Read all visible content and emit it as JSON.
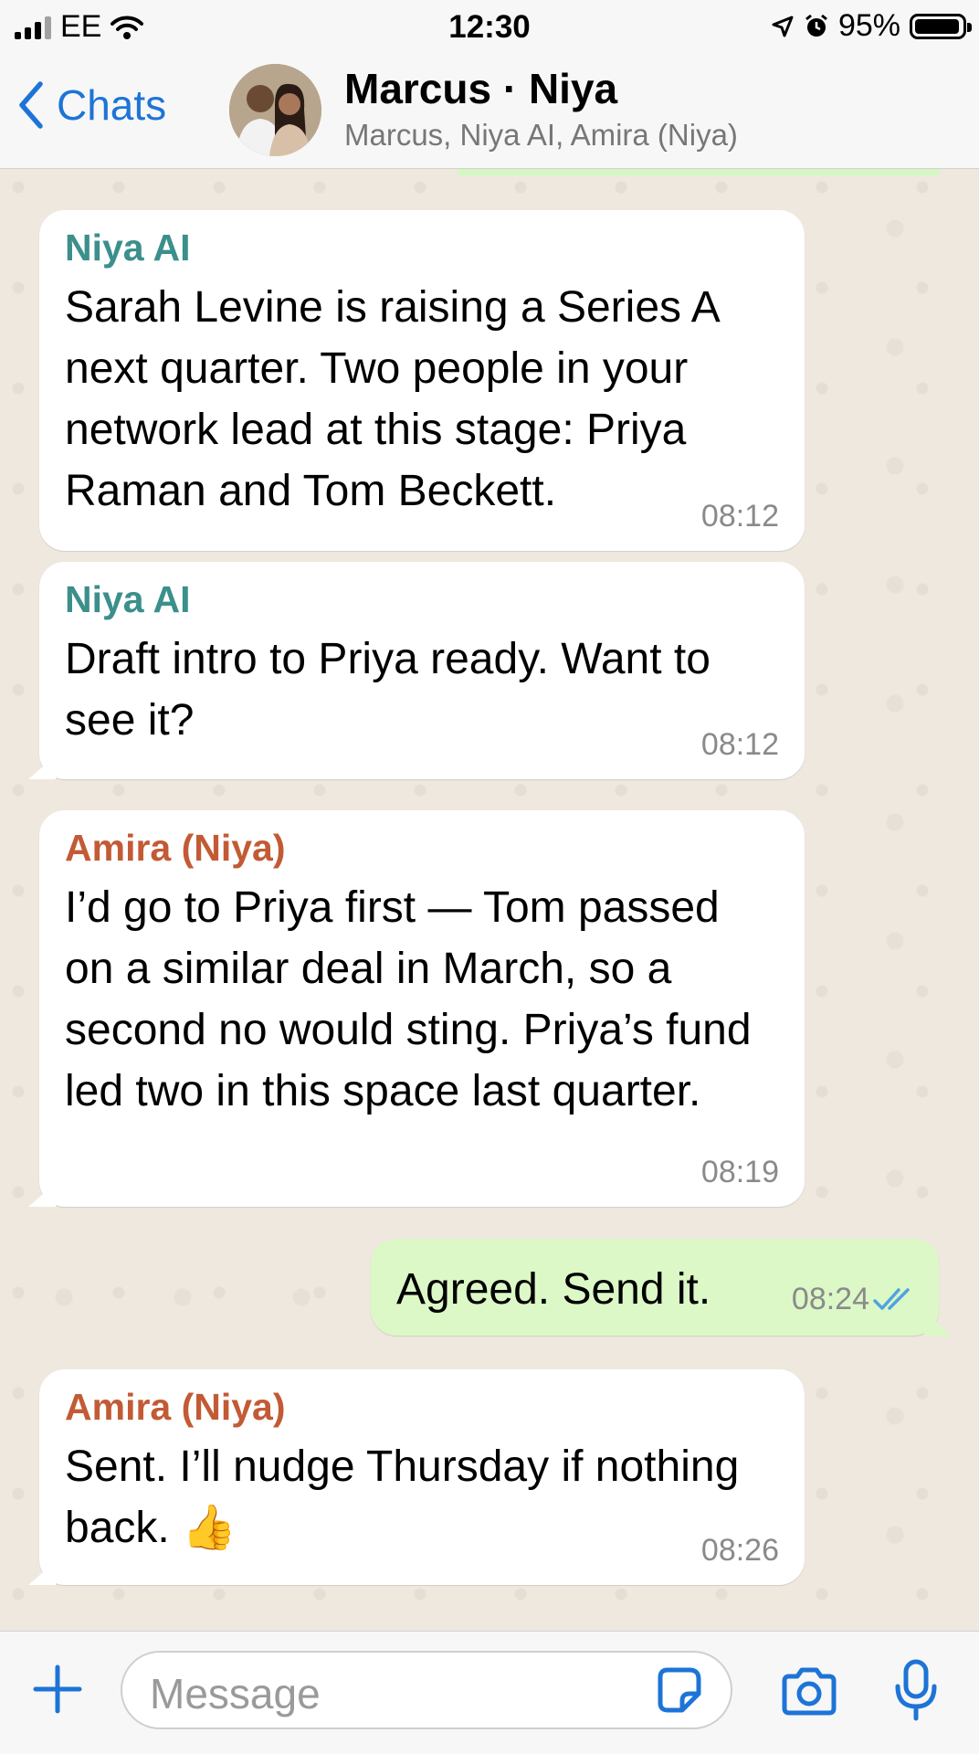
{
  "status_bar": {
    "carrier": "EE",
    "time": "12:30",
    "battery": "95%",
    "battery_level": 0.95,
    "icons": [
      "signal-icon",
      "wifi-icon",
      "location-icon",
      "alarm-icon",
      "battery-icon"
    ]
  },
  "header": {
    "back_label": "Chats",
    "title": "Marcus · Niya",
    "subtitle": "Marcus, Niya AI, Amira (Niya)"
  },
  "messages": [
    {
      "sender": "Niya AI",
      "text": "Sarah Levine is raising a Series A next quarter. Two people in your network lead at this stage: Priya Raman and Tom Beckett.",
      "time": "08:12",
      "direction": "in"
    },
    {
      "sender": "Niya AI",
      "text": "Draft intro to Priya ready. Want to see it?",
      "time": "08:12",
      "direction": "in"
    },
    {
      "sender": "Amira (Niya)",
      "text": "I’d go to Priya first — Tom passed on a similar deal in March, so a second no would sting. Priya’s fund led two in this space last quarter.",
      "time": "08:19",
      "direction": "in"
    },
    {
      "sender": "",
      "text": "Agreed. Send it.",
      "time": "08:24",
      "direction": "out",
      "status": "read"
    },
    {
      "sender": "Amira (Niya)",
      "text": "Sent. I’ll nudge Thursday if nothing back. 👍",
      "time": "08:26",
      "direction": "in"
    }
  ],
  "input": {
    "placeholder": "Message"
  },
  "colors": {
    "accent": "#1d74d6",
    "ai_sender": "#3b8f8c",
    "human_sender": "#c25b35",
    "outgoing_bubble": "#dcf8c6",
    "chat_background": "#efe8df"
  }
}
